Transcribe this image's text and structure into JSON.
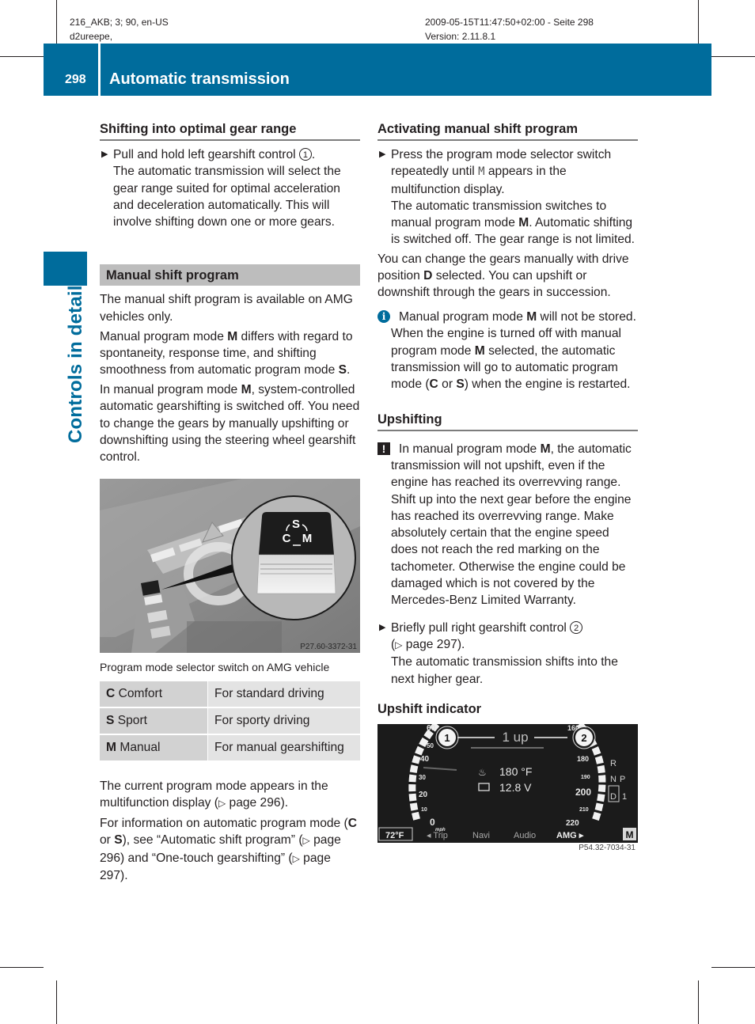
{
  "print_meta": {
    "left_line1": "216_AKB; 3; 90, en-US",
    "left_line2": "d2ureepe,",
    "right_line1": "2009-05-15T11:47:50+02:00 - Seite 298",
    "right_line2": "Version: 2.11.8.1"
  },
  "header": {
    "page_number": "298",
    "title": "Automatic transmission"
  },
  "sidebar": {
    "section_label": "Controls in detail"
  },
  "left_column": {
    "shifting": {
      "heading": "Shifting into optimal gear range",
      "step_prefix": "Pull and hold left gearshift control ",
      "step_callout": "1",
      "step_suffix": ".",
      "result": "The automatic transmission will select the gear range suited for optimal acceleration and deceleration automatically. This will involve shifting down one or more gears."
    },
    "manual": {
      "heading": "Manual shift program",
      "p1": "The manual shift program is available on AMG vehicles only.",
      "p2_a": "Manual program mode ",
      "p2_b": "M",
      "p2_c": " differs with regard to spontaneity, response time, and shifting smoothness from automatic program mode ",
      "p2_d": "S",
      "p2_e": ".",
      "p3_a": "In manual program mode ",
      "p3_b": "M",
      "p3_c": ", system-controlled automatic gearshifting is switched off. You need to change the gears by manually upshifting or downshifting using the steering wheel gearshift control."
    },
    "figure1": {
      "switch_letters": {
        "top": "S",
        "left": "C",
        "right": "M"
      },
      "code": "P27.60-3372-31",
      "caption": "Program mode selector switch on AMG vehicle"
    },
    "mode_table": [
      {
        "letter": "C",
        "name": " Comfort",
        "description": "For standard driving"
      },
      {
        "letter": "S",
        "name": " Sport",
        "description": "For sporty driving"
      },
      {
        "letter": "M",
        "name": " Manual",
        "description": "For manual gearshifting"
      }
    ],
    "after_table": {
      "p1_a": "The current program mode appears in the multifunction display (",
      "p1_ref": "page 296",
      "p1_b": ").",
      "p2_a": "For information on automatic program mode (",
      "p2_c": "C",
      "p2_or": " or ",
      "p2_s": "S",
      "p2_b": "), see “Automatic shift program” (",
      "p2_ref1": "page 296",
      "p2_mid": ") and “One-touch gearshifting” (",
      "p2_ref2": "page 297",
      "p2_end": ")."
    }
  },
  "right_column": {
    "activating": {
      "heading": "Activating manual shift program",
      "step_a": "Press the program mode selector switch repeatedly until ",
      "step_symbol": "M",
      "step_b": " appears in the multifunction display.",
      "result_a": "The automatic transmission switches to manual program mode ",
      "result_m": "M",
      "result_b": ". Automatic shifting is switched off. The gear range is not limited.",
      "p_a": "You can change the gears manually with drive position ",
      "p_d": "D",
      "p_b": " selected. You can upshift or downshift through the gears in succession."
    },
    "info_note": {
      "icon": "info-icon",
      "a": "Manual program mode ",
      "m1": "M",
      "b": " will not be stored. When the engine is turned off with manual program mode ",
      "m2": "M",
      "c": " selected, the automatic transmission will go to automatic program mode (",
      "cc": "C",
      "or": " or ",
      "ss": "S",
      "d": ") when the engine is restarted."
    },
    "upshifting": {
      "heading": "Upshifting",
      "warning": {
        "icon": "warning-icon",
        "a": "In manual program mode ",
        "m": "M",
        "b": ", the automatic transmission will not upshift, even if the engine has reached its overrevving range. Shift up into the next gear before the engine has reached its overrevving range. Make absolutely certain that the engine speed does not reach the red marking on the tachometer. Otherwise the engine could be damaged which is not covered by the Mercedes-Benz Limited Warranty."
      },
      "step_a": "Briefly pull right gearshift control ",
      "step_callout": "2",
      "step_ref_a": "(",
      "step_ref": "page 297",
      "step_ref_b": ").",
      "result": "The automatic transmission shifts into the next higher gear."
    },
    "upshift_indicator": {
      "heading": "Upshift indicator",
      "display": {
        "callout1": "1",
        "callout2": "2",
        "message": "1 up",
        "oil_temp": "180 °F",
        "battery": "12.8 V",
        "outside_temp": "72°F",
        "menu": [
          "◂ Trip",
          "Navi",
          "Audio",
          "AMG ▸"
        ],
        "mode": "M",
        "speed_unit": "mph",
        "left_scale": [
          "60",
          "50",
          "40",
          "30",
          "20",
          "10",
          "0"
        ],
        "right_scale": [
          "160",
          "180",
          "190",
          "200",
          "210",
          "220"
        ],
        "gears": [
          "R",
          "N",
          "D"
        ],
        "gear_p": "P",
        "current_gear": "1"
      },
      "code": "P54.32-7034-31"
    }
  }
}
